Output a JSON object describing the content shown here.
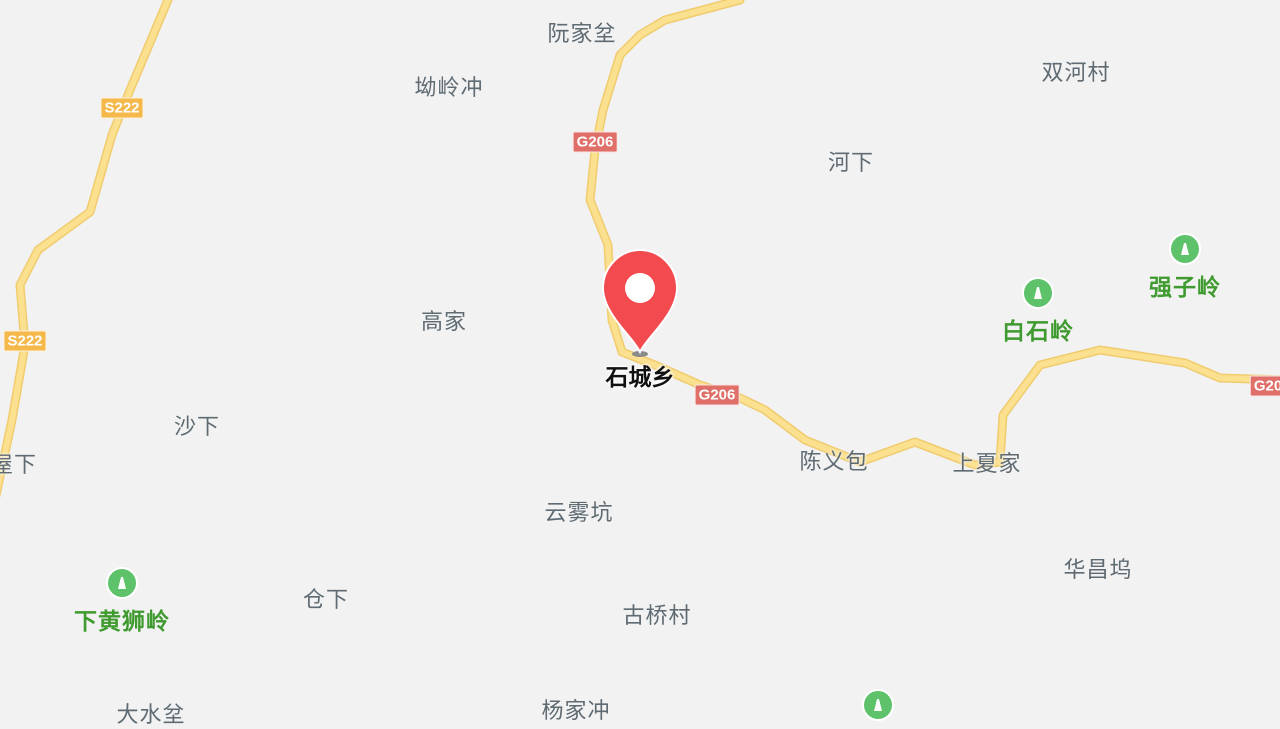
{
  "map": {
    "background": "#f2f2f2",
    "road_color": "#fbe08f",
    "pin_color": "#f24a4f",
    "selected_place": "石城乡",
    "places": [
      {
        "id": "ruanjiaben",
        "name": "阮家坌"
      },
      {
        "id": "aolingchong",
        "name": "坳岭冲"
      },
      {
        "id": "shuanghecun",
        "name": "双河村"
      },
      {
        "id": "hexia",
        "name": "河下"
      },
      {
        "id": "gaojia",
        "name": "高家"
      },
      {
        "id": "shaxia",
        "name": "沙下"
      },
      {
        "id": "wuxia",
        "name": "屋下"
      },
      {
        "id": "chenyibao",
        "name": "陈义包"
      },
      {
        "id": "shangxiajia",
        "name": "上夏家"
      },
      {
        "id": "yunwukeng",
        "name": "云雾坑"
      },
      {
        "id": "huachangwu",
        "name": "华昌坞"
      },
      {
        "id": "cangxia",
        "name": "仓下"
      },
      {
        "id": "guqiaocun",
        "name": "古桥村"
      },
      {
        "id": "yangjiachong",
        "name": "杨家冲"
      },
      {
        "id": "dashuiben",
        "name": "大水坌"
      }
    ],
    "peaks": [
      {
        "id": "qiangziling",
        "name": "强子岭"
      },
      {
        "id": "baishiling",
        "name": "白石岭"
      },
      {
        "id": "xiahuangshiling",
        "name": "下黄狮岭"
      },
      {
        "id": "bottom-peak",
        "name": ""
      }
    ],
    "road_shields": [
      {
        "id": "s222-top",
        "code": "S222",
        "type": "provincial"
      },
      {
        "id": "s222-mid",
        "code": "S222",
        "type": "provincial"
      },
      {
        "id": "g206-top",
        "code": "G206",
        "type": "national"
      },
      {
        "id": "g206-mid",
        "code": "G206",
        "type": "national"
      },
      {
        "id": "g206-right",
        "code": "G20",
        "type": "national"
      }
    ]
  }
}
